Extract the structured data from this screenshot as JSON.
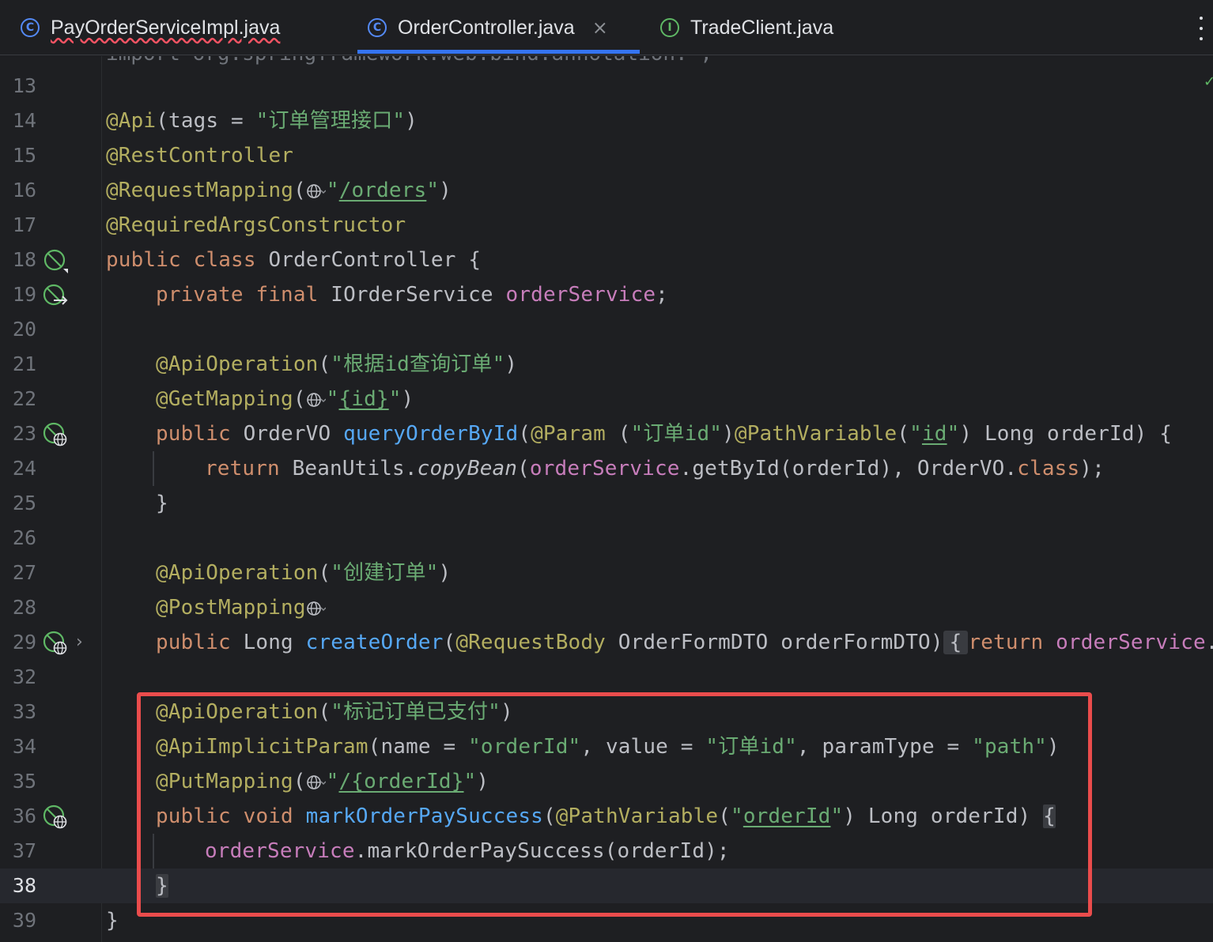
{
  "tabs": [
    {
      "label": "PayOrderServiceImpl.java",
      "icon": "class-icon",
      "has_error": true
    },
    {
      "label": "OrderController.java",
      "icon": "class-icon",
      "active": true,
      "close": "×"
    },
    {
      "label": "TradeClient.java",
      "icon": "interface-icon"
    }
  ],
  "icons": {
    "class_glyph": "C",
    "interface_glyph": "I"
  },
  "colors": {
    "accent": "#3574f0",
    "highlight_box": "#ea4c4c",
    "annotation": "#b3ae60",
    "keyword": "#cf8e6d",
    "string": "#6aab73",
    "field": "#c77dbb",
    "method": "#56a8f5"
  },
  "editor": {
    "current_line": "38",
    "top_clipped": "import org.springframework.web.bind.annotation.*;",
    "lines": {
      "l13": {
        "num": "13"
      },
      "l14": {
        "num": "14",
        "t1": "@Api",
        "t2": "(tags = ",
        "t3": "\"订单管理接口\"",
        "t4": ")"
      },
      "l15": {
        "num": "15",
        "t1": "@RestController"
      },
      "l16": {
        "num": "16",
        "t1": "@RequestMapping",
        "t2": "(",
        "t3": "\"",
        "t4": "/orders",
        "t5": "\"",
        "t6": ")"
      },
      "l17": {
        "num": "17",
        "t1": "@RequiredArgsConstructor"
      },
      "l18": {
        "num": "18",
        "t1": "public",
        "t2": " ",
        "t3": "class",
        "t4": " OrderController {"
      },
      "l19": {
        "num": "19",
        "t1": "private",
        "t2": " ",
        "t3": "final",
        "t4": " IOrderService ",
        "t5": "orderService",
        "t6": ";"
      },
      "l20": {
        "num": "20"
      },
      "l21": {
        "num": "21",
        "t1": "@ApiOperation",
        "t2": "(",
        "t3": "\"根据id查询订单\"",
        "t4": ")"
      },
      "l22": {
        "num": "22",
        "t1": "@GetMapping",
        "t2": "(",
        "t3": "\"",
        "t4": "{id}",
        "t5": "\"",
        "t6": ")"
      },
      "l23": {
        "num": "23",
        "t1": "public",
        "t2": " OrderVO ",
        "t3": "queryOrderById",
        "t4": "(",
        "t5": "@Param",
        "t6": " (",
        "t7": "\"订单id\"",
        "t8": ")",
        "t9": "@PathVariable",
        "t10": "(",
        "t11": "\"",
        "t12": "id",
        "t13": "\"",
        "t14": ") Long orderId) {"
      },
      "l24": {
        "num": "24",
        "t1": "return",
        "t2": " BeanUtils.",
        "t3": "copyBean",
        "t4": "(",
        "t5": "orderService",
        "t6": ".getById(orderId), OrderVO.",
        "t7": "class",
        "t8": ");"
      },
      "l25": {
        "num": "25",
        "t1": "}"
      },
      "l26": {
        "num": "26"
      },
      "l27": {
        "num": "27",
        "t1": "@ApiOperation",
        "t2": "(",
        "t3": "\"创建订单\"",
        "t4": ")"
      },
      "l28": {
        "num": "28",
        "t1": "@PostMapping"
      },
      "l29": {
        "num": "29",
        "t1": "public",
        "t2": " Long ",
        "t3": "createOrder",
        "t4": "(",
        "t5": "@RequestBody",
        "t6": " OrderFormDTO orderFormDTO)",
        "t7": "{",
        "t8": "return",
        "t9": " ",
        "t10": "orderService",
        "t11": "."
      },
      "l32": {
        "num": "32"
      },
      "l33": {
        "num": "33",
        "t1": "@ApiOperation",
        "t2": "(",
        "t3": "\"标记订单已支付\"",
        "t4": ")"
      },
      "l34": {
        "num": "34",
        "t1": "@ApiImplicitParam",
        "t2": "(name = ",
        "t3": "\"orderId\"",
        "t4": ", value = ",
        "t5": "\"订单id\"",
        "t6": ", paramType = ",
        "t7": "\"path\"",
        "t8": ")"
      },
      "l35": {
        "num": "35",
        "t1": "@PutMapping",
        "t2": "(",
        "t3": "\"",
        "t4": "/{orderId}",
        "t5": "\"",
        "t6": ")"
      },
      "l36": {
        "num": "36",
        "t1": "public",
        "t2": " ",
        "t3": "void",
        "t4": " ",
        "t5": "markOrderPaySuccess",
        "t6": "(",
        "t7": "@PathVariable",
        "t8": "(",
        "t9": "\"",
        "t10": "orderId",
        "t11": "\"",
        "t12": ") Long orderId) ",
        "t13": "{"
      },
      "l37": {
        "num": "37",
        "t1": "orderService",
        "t2": ".markOrderPaySuccess(orderId);"
      },
      "l38": {
        "num": "38",
        "t1": "}"
      },
      "l39": {
        "num": "39",
        "t1": "}"
      }
    }
  }
}
